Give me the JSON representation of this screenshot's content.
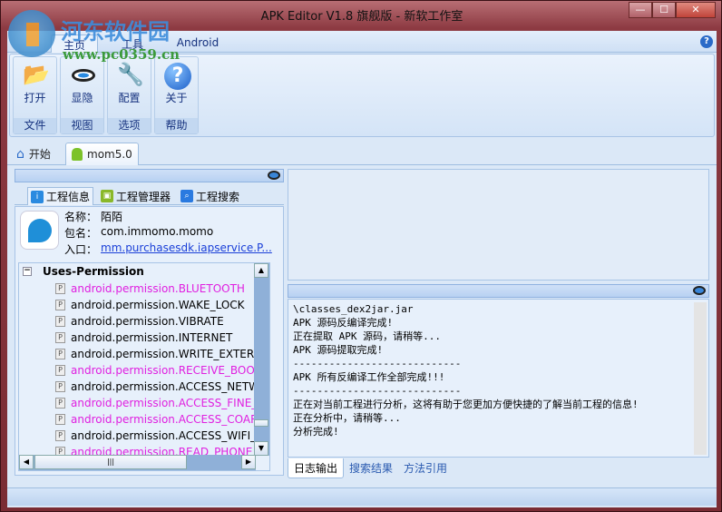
{
  "window": {
    "title": "APK Editor V1.8 旗舰版 - 新软工作室",
    "minimize": "—",
    "maximize": "☐",
    "close": "✕"
  },
  "watermark": {
    "name": "河东软件园",
    "url": "www.pc0359.cn"
  },
  "ribbon": {
    "tabs": [
      "主页",
      "工具",
      "Android"
    ],
    "groups": [
      {
        "button": "打开",
        "group": "文件",
        "icon": "folder-open-icon"
      },
      {
        "button": "显隐",
        "group": "视图",
        "icon": "eye-icon"
      },
      {
        "button": "配置",
        "group": "选项",
        "icon": "tools-icon"
      },
      {
        "button": "关于",
        "group": "帮助",
        "icon": "help-icon"
      }
    ]
  },
  "doc_tabs": [
    "开始",
    "mom5.0"
  ],
  "project_tabs": [
    "工程信息",
    "工程管理器",
    "工程搜索"
  ],
  "info": {
    "name_label": "名称：",
    "name": "陌陌",
    "package_label": "包名：",
    "package": "com.immomo.momo",
    "entry_label": "入口：",
    "entry": "mm.purchasesdk.iapservice.P..."
  },
  "tree": {
    "root": "Uses-Permission",
    "items": [
      {
        "text": "android.permission.BLUETOOTH",
        "color": "#e020e0"
      },
      {
        "text": "android.permission.WAKE_LOCK",
        "color": "#000000"
      },
      {
        "text": "android.permission.VIBRATE",
        "color": "#000000"
      },
      {
        "text": "android.permission.INTERNET",
        "color": "#000000"
      },
      {
        "text": "android.permission.WRITE_EXTERI",
        "color": "#000000"
      },
      {
        "text": "android.permission.RECEIVE_BOO",
        "color": "#e020e0"
      },
      {
        "text": "android.permission.ACCESS_NETW",
        "color": "#000000"
      },
      {
        "text": "android.permission.ACCESS_FINE_",
        "color": "#e020e0"
      },
      {
        "text": "android.permission.ACCESS_COAR",
        "color": "#e020e0"
      },
      {
        "text": "android.permission.ACCESS_WIFI_",
        "color": "#000000"
      },
      {
        "text": "android.permission.READ_PHONE",
        "color": "#e020e0"
      }
    ]
  },
  "log": {
    "lines": [
      "\\classes_dex2jar.jar",
      "APK 源码反编译完成!",
      "正在提取 APK 源码，请稍等...",
      "APK 源码提取完成!",
      "----------------------------",
      "APK 所有反编译工作全部完成!!!",
      "----------------------------",
      "正在对当前工程进行分析，这将有助于您更加方便快捷的了解当前工程的信息!",
      "正在分析中，请稍等...",
      "分析完成!"
    ],
    "tabs": [
      "日志输出",
      "搜索结果",
      "方法引用"
    ]
  }
}
